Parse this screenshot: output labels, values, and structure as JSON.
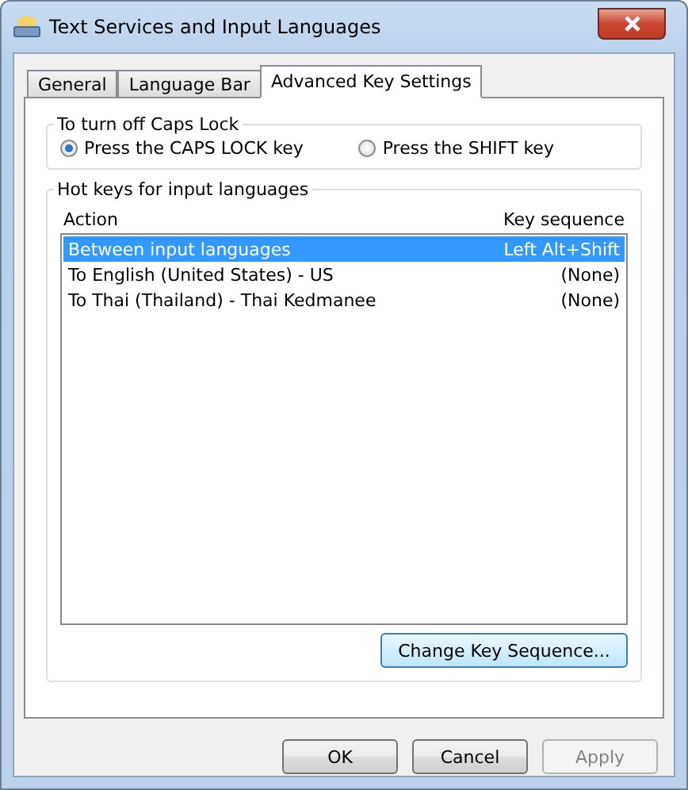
{
  "window": {
    "title": "Text Services and Input Languages"
  },
  "tabs": [
    {
      "label": "General",
      "selected": false
    },
    {
      "label": "Language Bar",
      "selected": false
    },
    {
      "label": "Advanced Key Settings",
      "selected": true
    }
  ],
  "caps_lock": {
    "title": "To turn off Caps Lock",
    "options": [
      {
        "label": "Press the CAPS LOCK key",
        "selected": true
      },
      {
        "label": "Press the SHIFT key",
        "selected": false
      }
    ]
  },
  "hot_keys": {
    "title": "Hot keys for input languages",
    "columns": [
      "Action",
      "Key sequence"
    ],
    "rows": [
      {
        "action": "Between input languages",
        "key_sequence": "Left Alt+Shift",
        "selected": true
      },
      {
        "action": "To English (United States) - US",
        "key_sequence": "(None)",
        "selected": false
      },
      {
        "action": "To Thai (Thailand) - Thai Kedmanee",
        "key_sequence": "(None)",
        "selected": false
      }
    ],
    "button": {
      "label": "Change Key Sequence...",
      "focused": true
    }
  },
  "buttons": [
    {
      "label": "OK",
      "disabled": false
    },
    {
      "label": "Cancel",
      "disabled": false
    },
    {
      "label": "Apply",
      "disabled": true
    }
  ]
}
